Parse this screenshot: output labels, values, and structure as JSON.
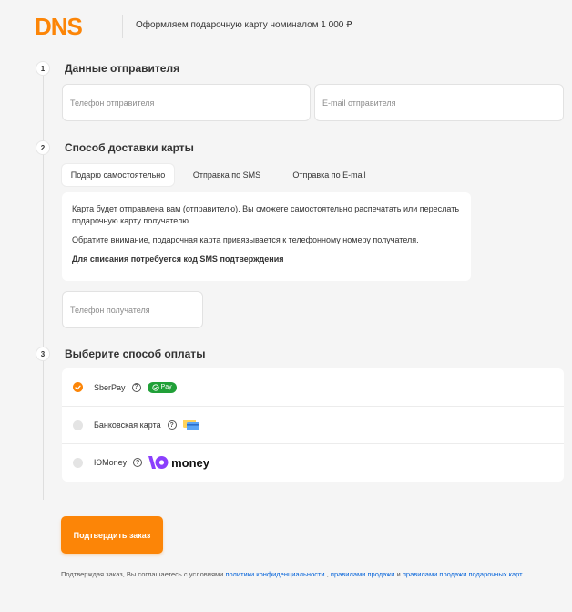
{
  "header": {
    "logo_text": "DNS",
    "title": "Оформляем подарочную карту номиналом 1 000 ₽"
  },
  "steps": [
    {
      "number": "1",
      "title": "Данные отправителя"
    },
    {
      "number": "2",
      "title": "Способ доставки карты"
    },
    {
      "number": "3",
      "title": "Выберите способ оплаты"
    }
  ],
  "sender": {
    "phone_placeholder": "Телефон отправителя",
    "email_placeholder": "E-mail отправителя"
  },
  "delivery": {
    "tabs": [
      "Подарю самостоятельно",
      "Отправка по SMS",
      "Отправка по E-mail"
    ],
    "active_tab": 0,
    "info": [
      "Карта будет отправлена вам (отправителю). Вы сможете самостоятельно распечатать или переслать подарочную карту получателю.",
      "Обратите внимание, подарочная карта привязывается к телефонному номеру получателя.",
      "Для списания потребуется код SMS подтверждения"
    ],
    "recipient_phone_placeholder": "Телефон получателя"
  },
  "payment": {
    "selected": 0,
    "options": [
      {
        "label": "SberPay",
        "help": "?",
        "badge": "Pay",
        "icon": "sberpay-badge-icon"
      },
      {
        "label": "Банковская карта",
        "help": "?",
        "icon": "bank-card-icon"
      },
      {
        "label": "ЮMoney",
        "help": "?",
        "logo_text": "money",
        "icon": "yoomoney-logo-icon"
      }
    ]
  },
  "confirm_label": "Подтвердить заказ",
  "footer": {
    "prefix": "Подтверждая заказ, Вы соглашаетесь с условиями",
    "link_privacy": "политики конфиденциальности",
    "sep1": ",",
    "link_sales": "правилами продажи",
    "sep2": "и",
    "link_gift": "правилами продажи подарочных карт",
    "suffix": "."
  },
  "colors": {
    "accent": "#fc8507",
    "link": "#0061d9",
    "sber_green": "#21a038",
    "yoomoney_purple": "#8b3ffd",
    "background": "#f5f5f5"
  }
}
